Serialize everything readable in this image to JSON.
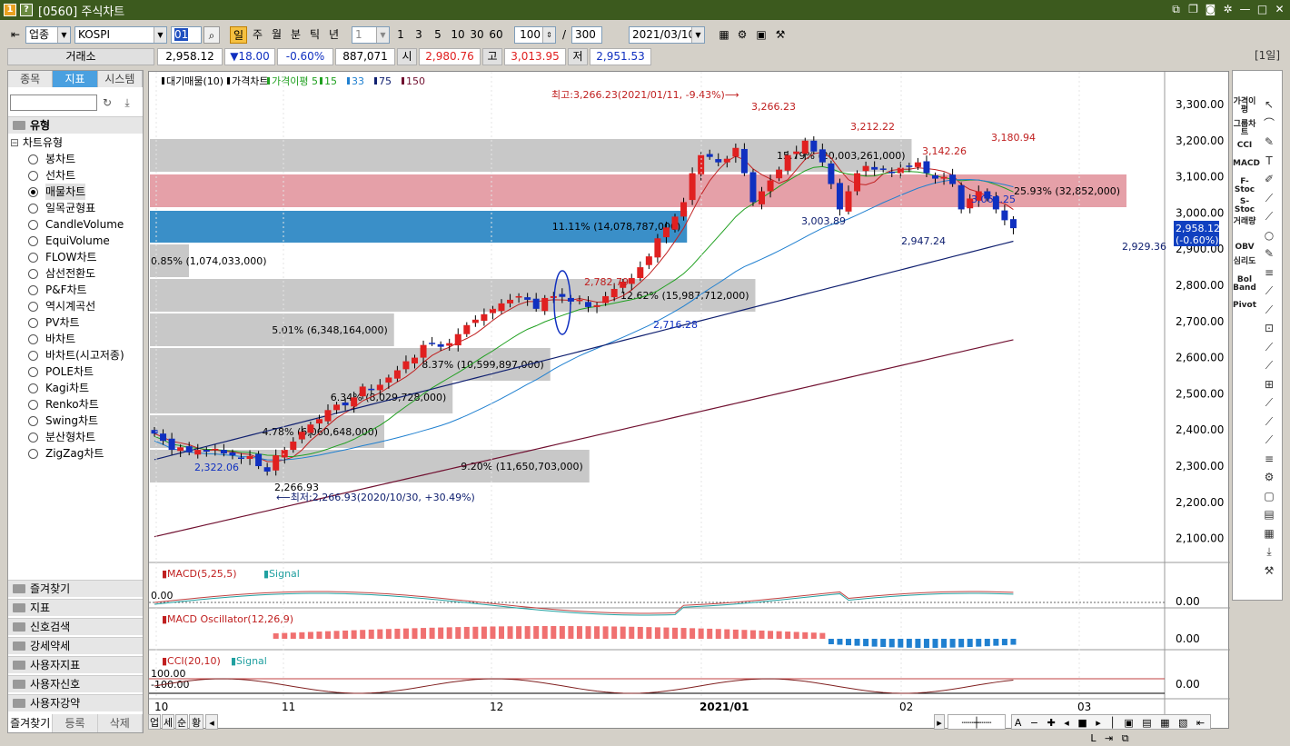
{
  "window": {
    "icon1": "1",
    "icon2": "?",
    "title": "[0560] 주식차트"
  },
  "toolbar": {
    "market_type": "업종",
    "symbol": "KOSPI",
    "code_box": "01",
    "periods": [
      "일",
      "주",
      "월",
      "분",
      "틱",
      "년"
    ],
    "active_period": "일",
    "interval": "1",
    "multipliers": [
      "1",
      "3",
      "5",
      "10",
      "30",
      "60"
    ],
    "count": "100",
    "separator": "/",
    "total": "300",
    "date": "2021/03/10"
  },
  "infobar": {
    "exchange": "거래소",
    "price": "2,958.12",
    "change": "▼18.00",
    "change_pct": "-0.60%",
    "volume": "887,071",
    "open_label": "시",
    "open": "2,980.76",
    "high_label": "고",
    "high": "3,013.95",
    "low_label": "저",
    "low": "2,951.53",
    "period_badge": "[1일]"
  },
  "leftpanel": {
    "tabs": [
      "종목",
      "지표",
      "시스템"
    ],
    "active_tab": "지표",
    "section_type": "유형",
    "tree_root": "차트유형",
    "chart_types": [
      "봉차트",
      "선차트",
      "매물차트",
      "일목균형표",
      "CandleVolume",
      "EquiVolume",
      "FLOW차트",
      "삼선전환도",
      "P&F차트",
      "역시계곡선",
      "PV차트",
      "바차트",
      "바차트(시고저종)",
      "POLE차트",
      "Kagi차트",
      "Renko차트",
      "Swing차트",
      "분산형차트",
      "ZigZag차트"
    ],
    "selected_type": "매물차트",
    "sections": [
      "즐겨찾기",
      "지표",
      "신호검색",
      "강세약세",
      "사용자지표",
      "사용자신호",
      "사용자강약"
    ],
    "bottom_tabs": [
      "즐겨찾기",
      "등록",
      "삭제"
    ]
  },
  "chart": {
    "legend": [
      "대기매물(10)",
      "가격차트",
      "가격이평 5",
      "15",
      "33",
      "75",
      "150"
    ],
    "y_axis": [
      "3,300.00",
      "3,200.00",
      "3,100.00",
      "3,000.00",
      "2,900.00",
      "2,800.00",
      "2,700.00",
      "2,600.00",
      "2,500.00",
      "2,400.00",
      "2,300.00",
      "2,200.00",
      "2,100.00"
    ],
    "x_axis": [
      "10",
      "11",
      "12",
      "2021/01",
      "02",
      "03"
    ],
    "max_note": "최고:3,266.23(2021/01/11, -9.43%)⟶",
    "min_note": "⟵최저:2,266.93(2020/10/30, +30.49%)",
    "current_price": "2,958.12",
    "current_pct": "(-0.60%)",
    "price_labels": [
      "3,266.23",
      "3,212.22",
      "3,142.26",
      "3,180.94",
      "3,003.89",
      "2,947.24",
      "3,064.25",
      "2,929.36",
      "2,782.79",
      "2,716.28",
      "2,322.06",
      "2,266.93"
    ],
    "volume_profile": [
      {
        "label": "15.79% (20,003,261,000)",
        "frac": 0.78,
        "color": "#c8c8c8"
      },
      {
        "label": "25.93% (32,852,000)",
        "frac": 1.0,
        "color": "#e5a0a8"
      },
      {
        "label": "11.11% (14,078,787,000)",
        "frac": 0.55,
        "color": "#3a8fc8"
      },
      {
        "label": "0.85% (1,074,033,000)",
        "frac": 0.04,
        "color": "#c8c8c8"
      },
      {
        "label": "12.62% (15,987,712,000)",
        "frac": 0.62,
        "color": "#c8c8c8"
      },
      {
        "label": "5.01% (6,348,164,000)",
        "frac": 0.25,
        "color": "#c8c8c8"
      },
      {
        "label": "8.37% (10,599,897,000)",
        "frac": 0.41,
        "color": "#c8c8c8"
      },
      {
        "label": "6.34% (8,029,728,000)",
        "frac": 0.31,
        "color": "#c8c8c8"
      },
      {
        "label": "4.78% (6,060,648,000)",
        "frac": 0.24,
        "color": "#c8c8c8"
      },
      {
        "label": "9.20% (11,650,703,000)",
        "frac": 0.45,
        "color": "#c8c8c8"
      }
    ],
    "macd_legend": [
      "MACD(5,25,5)",
      "Signal"
    ],
    "macd_left": "0.00",
    "macd_zero": "0.00",
    "osc_legend": "MACD Oscillator(12,26,9)",
    "osc_zero": "0.00",
    "cci_legend": [
      "CCI(20,10)",
      "Signal"
    ],
    "cci_hi": "100.00",
    "cci_lo": "-100.00",
    "cci_zero": "0.00"
  },
  "rightpanel": {
    "items": [
      "가격이평",
      "그룹차트",
      "CCI",
      "MACD",
      "F-Stoc",
      "S-Stoc",
      "거래량",
      "OBV",
      "심리도",
      "Bol Band",
      "Pivot"
    ]
  },
  "bottombar": {
    "tabs": [
      "업",
      "세",
      "순",
      "황"
    ]
  },
  "colors": {
    "up": "#e02020",
    "down": "#1030c0",
    "ma5": "#c02020",
    "ma15": "#20a020",
    "ma33": "#2080d0",
    "ma75": "#102070",
    "ma150": "#701030",
    "title_bg": "#3c5a1e"
  }
}
